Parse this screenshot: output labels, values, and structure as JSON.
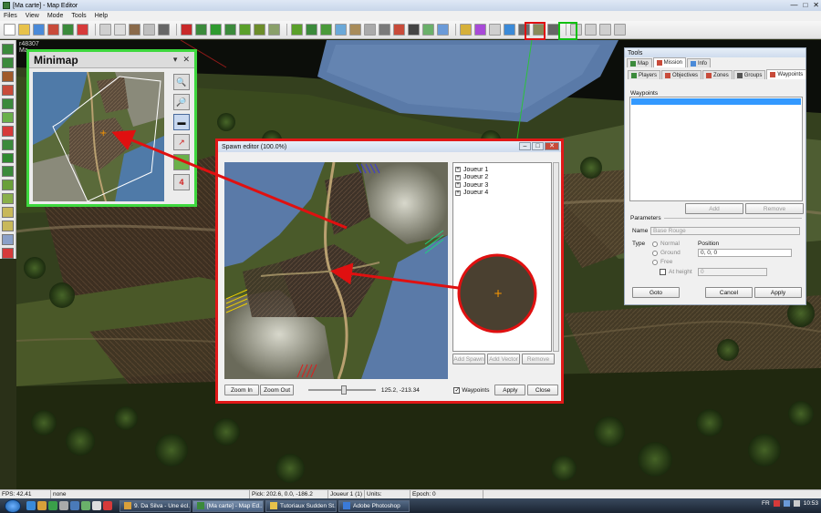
{
  "window": {
    "title": "[Ma carte] - Map Editor",
    "controls": [
      "—",
      "□",
      "✕"
    ]
  },
  "menu": {
    "items": [
      "Files",
      "View",
      "Mode",
      "Tools",
      "Help"
    ]
  },
  "toolbar": {
    "groups": [
      [
        "#fff",
        "#e8c24a",
        "#4a8ad8",
        "#c84b3a",
        "#3b8a3b",
        "#d63a3a"
      ],
      [
        "#cfcfcf",
        "#ddd",
        "#8a6a4a",
        "#bfbfbf",
        "#666"
      ],
      [
        "#c82a2a",
        "#3b8a3b",
        "#2f9a2f",
        "#3b8a3b",
        "#5aa02a",
        "#6c8d2a",
        "#8aa06a"
      ],
      [
        "#5aa02a",
        "#3b8a3b",
        "#4a9a3a",
        "#6aa8d8",
        "#a88c5a",
        "#aaaaaa",
        "#7a7a7a",
        "#c84b3a",
        "#444",
        "#6ab06a",
        "#6a9ad8"
      ],
      [
        "#d6b03a",
        "#a84ad8",
        "#cfcfcf",
        "#3b8ad8",
        "#6a6a6a",
        "#8a8a5a",
        "#666"
      ],
      [
        "#cfcfcf",
        "#cfcfcf",
        "#cfcfcf",
        "#cfcfcf"
      ]
    ]
  },
  "left_tools": [
    "#3b8a3b",
    "#3b8a3b",
    "#a05a2a",
    "#c84b3a",
    "#3b8a3b",
    "#6ab04a",
    "#d63a3a",
    "#3b8a3b",
    "#2f8a2f",
    "#3b8a3b",
    "#6aa03a",
    "#8ab04a",
    "#c8b85a",
    "#c8b85a",
    "#8aa0c8",
    "#d63a3a"
  ],
  "viewport": {
    "coord_label": "r48307",
    "map_label": "Ma"
  },
  "minimap": {
    "title": "Minimap"
  },
  "spawn_editor": {
    "title": "Spawn editor (100.0%)",
    "players": [
      "Joueur 1",
      "Joueur 2",
      "Joueur 3",
      "Joueur 4"
    ],
    "buttons": {
      "add_spawn": "Add Spawn",
      "add_vector": "Add Vector",
      "remove": "Remove"
    },
    "zoom_in": "Zoom In",
    "zoom_out": "Zoom Out",
    "coords": "125.2, -213.34",
    "waypoints_checkbox": "Waypoints",
    "waypoints_checked": true,
    "apply": "Apply",
    "close": "Close"
  },
  "tools_panel": {
    "title": "Tools",
    "tabs": [
      {
        "label": "Map",
        "color": "#3b8a3b"
      },
      {
        "label": "Mission",
        "color": "#c84b3a"
      },
      {
        "label": "Info",
        "color": "#4a8ad8"
      }
    ],
    "subtabs": [
      {
        "label": "Players",
        "color": "#3b8a3b"
      },
      {
        "label": "Objectives",
        "color": "#c84b3a"
      },
      {
        "label": "Zones",
        "color": "#c84b3a"
      },
      {
        "label": "Groups",
        "color": "#555"
      },
      {
        "label": "Waypoints",
        "color": "#c84b3a"
      }
    ],
    "waypoints_label": "Waypoints",
    "add": "Add",
    "remove": "Remove",
    "parameters": "Parameters",
    "name_label": "Name",
    "name_value": "Base Rouge",
    "type_label": "Type",
    "types": [
      "Normal",
      "Ground",
      "Free"
    ],
    "position_label": "Position",
    "position_value": "0, 0, 0",
    "at_height": "At height",
    "height_value": "0",
    "goto": "Goto",
    "cancel": "Cancel",
    "apply": "Apply"
  },
  "statusbar": {
    "fps": "FPS: 42.41",
    "selection": "none",
    "pick": "Pick: 202.6, 0.0, -186.2",
    "player": "Joueur 1 (1)",
    "units": "Units:",
    "epoch": "Epoch: 0"
  },
  "taskbar": {
    "quick_launch": [
      "#3a8ad8",
      "#d8a03a",
      "#3aa04a",
      "#aaa",
      "#4a7ab8",
      "#6ab06a",
      "#ddd",
      "#d63a3a"
    ],
    "tasks": [
      {
        "label": "9. Da Silva - Une écl...",
        "color": "#d8a03a",
        "active": false
      },
      {
        "label": "[Ma carte] - Map Ed...",
        "color": "#3b8a3b",
        "active": true
      },
      {
        "label": "Tutoriaux Sudden St...",
        "color": "#e8c24a",
        "active": false
      },
      {
        "label": "Adobe Photoshop",
        "color": "#3a7ad8",
        "active": false
      }
    ],
    "lang": "FR",
    "time": "10:53"
  }
}
